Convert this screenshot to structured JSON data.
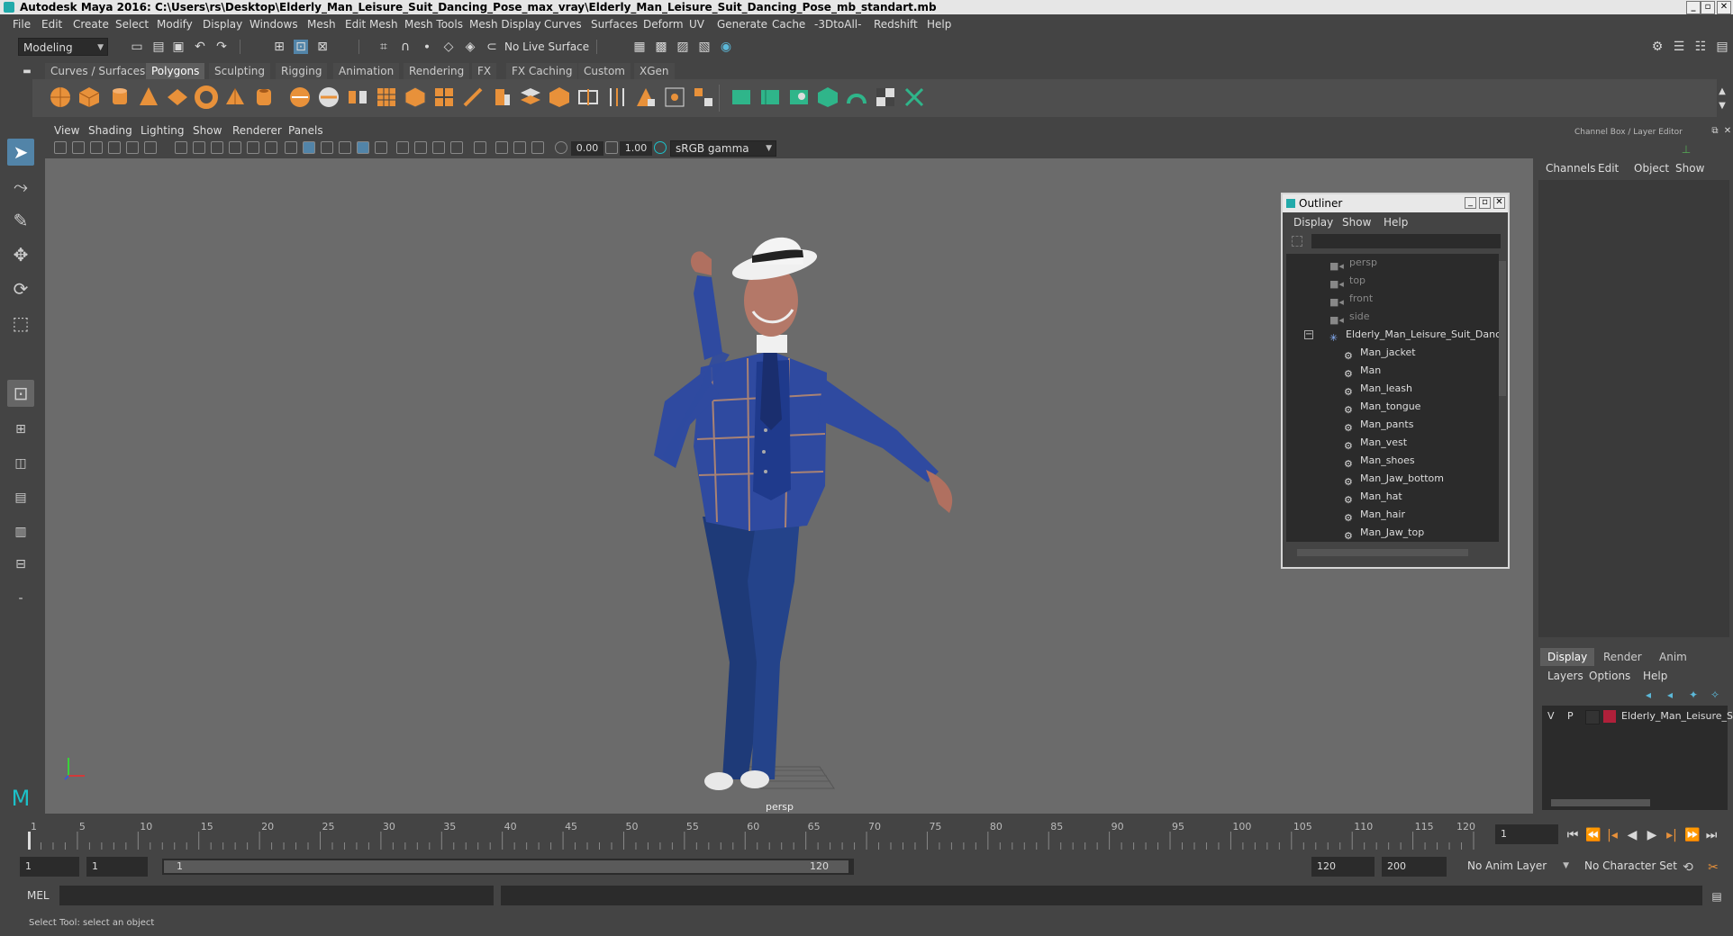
{
  "window": {
    "title": "Autodesk Maya 2016: C:\\Users\\rs\\Desktop\\Elderly_Man_Leisure_Suit_Dancing_Pose_max_vray\\Elderly_Man_Leisure_Suit_Dancing_Pose_mb_standart.mb"
  },
  "menubar": [
    "File",
    "Edit",
    "Create",
    "Select",
    "Modify",
    "Display",
    "Windows",
    "Mesh",
    "Edit Mesh",
    "Mesh Tools",
    "Mesh Display",
    "Curves",
    "Surfaces",
    "Deform",
    "UV",
    "Generate",
    "Cache",
    "-3DtoAll-",
    "Redshift",
    "Help"
  ],
  "statusline": {
    "mode": "Modeling",
    "live_surface": "No Live Surface"
  },
  "shelf": {
    "tabs": [
      "Curves / Surfaces",
      "Polygons",
      "Sculpting",
      "Rigging",
      "Animation",
      "Rendering",
      "FX",
      "FX Caching",
      "Custom",
      "XGen"
    ],
    "active_tab": "Polygons"
  },
  "viewport": {
    "menu": [
      "View",
      "Shading",
      "Lighting",
      "Show",
      "Renderer",
      "Panels"
    ],
    "exposure": "0.00",
    "gamma": "1.00",
    "color_space": "sRGB gamma",
    "camera_label": "persp"
  },
  "outliner": {
    "title": "Outliner",
    "menu": [
      "Display",
      "Show",
      "Help"
    ],
    "cameras": [
      "persp",
      "top",
      "front",
      "side"
    ],
    "root": "Elderly_Man_Leisure_Suit_Dancin",
    "children": [
      "Man_jacket",
      "Man",
      "Man_leash",
      "Man_tongue",
      "Man_pants",
      "Man_vest",
      "Man_shoes",
      "Man_Jaw_bottom",
      "Man_hat",
      "Man_hair",
      "Man_Jaw_top"
    ]
  },
  "channelbox": {
    "title": "Channel Box / Layer Editor",
    "menu": [
      "Channels",
      "Edit",
      "Object",
      "Show"
    ],
    "layer_tabs": [
      "Display",
      "Render",
      "Anim"
    ],
    "layer_menu": [
      "Layers",
      "Options",
      "Help"
    ],
    "layer": {
      "v": "V",
      "p": "P",
      "name": "Elderly_Man_Leisure_S",
      "color": "#b0203a"
    }
  },
  "timeline": {
    "ticks": [
      "1",
      "5",
      "10",
      "15",
      "20",
      "25",
      "30",
      "35",
      "40",
      "45",
      "50",
      "55",
      "60",
      "65",
      "70",
      "75",
      "80",
      "85",
      "90",
      "95",
      "100",
      "105",
      "110",
      "115",
      "120"
    ],
    "current_frame": "1"
  },
  "rangebar": {
    "start": "1",
    "playback_start": "1",
    "slider_start": "1",
    "slider_end": "120",
    "playback_end": "120",
    "end": "200",
    "anim_layer": "No Anim Layer",
    "char_set": "No Character Set"
  },
  "cmdline": {
    "label": "MEL"
  },
  "helpline": {
    "text": "Select Tool: select an object"
  },
  "colors": {
    "accent": "#5284a8",
    "viewport_bg": "#6b6b6b"
  }
}
